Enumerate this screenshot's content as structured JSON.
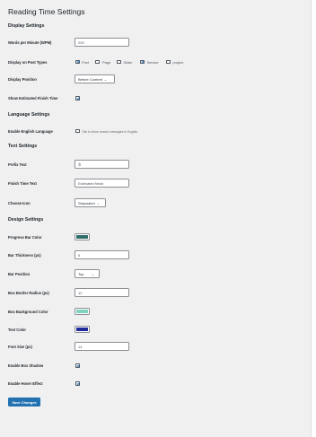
{
  "page_title": "Reading Time Settings",
  "sections": {
    "display": "Display Settings",
    "language": "Language Settings",
    "text": "Text Settings",
    "design": "Design Settings"
  },
  "display": {
    "wpm": {
      "label": "Words per Minute (WPM)",
      "value": "200"
    },
    "post_types": {
      "label": "Display on Post Types",
      "options": [
        {
          "label": "Post",
          "checked": true
        },
        {
          "label": "Page",
          "checked": false
        },
        {
          "label": "Slider",
          "checked": false
        },
        {
          "label": "Service",
          "checked": true
        },
        {
          "label": "project",
          "checked": false
        }
      ]
    },
    "position": {
      "label": "Display Position",
      "value": "Before Content"
    },
    "finish_time": {
      "label": "Show Estimated Finish Time",
      "checked": true
    }
  },
  "language": {
    "english": {
      "label": "Enable English Language",
      "checked": false,
      "description": "Tick to show reward messages in English."
    }
  },
  "text": {
    "prefix": {
      "label": "Prefix Text",
      "value": "⏱"
    },
    "finish_time_text": {
      "label": "Finish Time Text",
      "value": "Estimated finish"
    },
    "icon": {
      "label": "Choose Icon",
      "value": "Stopwatch"
    }
  },
  "design": {
    "progress_color": {
      "label": "Progress Bar Color",
      "color": "#2f6f6a"
    },
    "bar_thickness": {
      "label": "Bar Thickness (px)",
      "value": "5"
    },
    "bar_position": {
      "label": "Bar Position",
      "value": "Top"
    },
    "border_radius": {
      "label": "Box Border Radius (px)",
      "value": "12"
    },
    "box_bg_color": {
      "label": "Box Background Color",
      "color": "#7fd3bf"
    },
    "text_color": {
      "label": "Text Color",
      "color": "#1e2a9c"
    },
    "font_size": {
      "label": "Font Size (px)",
      "value": "14"
    },
    "box_shadow": {
      "label": "Enable Box Shadow",
      "checked": true
    },
    "hover_effect": {
      "label": "Enable Hover Effect",
      "checked": true
    }
  },
  "save_label": "Save Changes",
  "icons": {
    "chevron": "chevron-down-icon",
    "checkmark": "checkmark-icon"
  }
}
